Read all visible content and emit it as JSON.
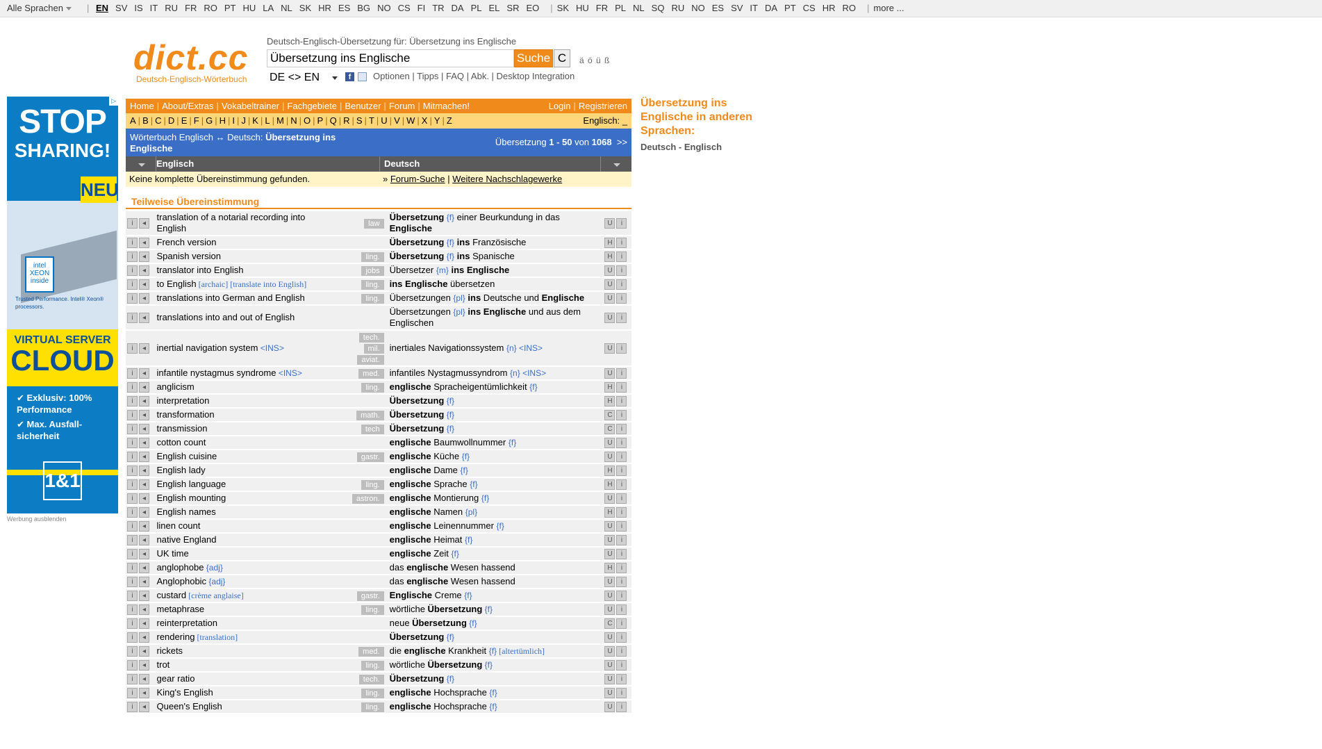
{
  "langbar": {
    "all_languages": "Alle Sprachen",
    "group1": [
      "EN",
      "SV",
      "IS",
      "IT",
      "RU",
      "FR",
      "RO",
      "PT",
      "HU",
      "LA",
      "NL",
      "SK",
      "HR",
      "ES",
      "BG",
      "NO",
      "CS",
      "FI",
      "TR",
      "DA",
      "PL",
      "EL",
      "SR",
      "EO"
    ],
    "group2": [
      "SK",
      "HU",
      "FR",
      "PL",
      "NL",
      "SQ",
      "RU",
      "NO",
      "ES",
      "SV",
      "IT",
      "DA",
      "PT",
      "CS",
      "HR",
      "RO"
    ],
    "more": "more ..."
  },
  "header": {
    "logo": "dict.cc",
    "logo_subtitle": "Deutsch-Englisch-Wörterbuch",
    "search_heading": "Deutsch-Englisch-Übersetzung für: Übersetzung ins Englische",
    "search_value": "Übersetzung ins Englische",
    "search_button": "Suche",
    "clear_button": "C",
    "special_chars": "ä ö ü ß",
    "lang_select": "DE <> EN",
    "util_links": "Optionen | Tipps | FAQ | Abk. | Desktop Integration"
  },
  "nav": {
    "items": [
      "Home",
      "About/Extras",
      "Vokabeltrainer",
      "Fachgebiete",
      "Benutzer",
      "Forum",
      "Mitmachen!"
    ],
    "login": "Login",
    "register": "Registrieren"
  },
  "alphabet": {
    "letters": [
      "A",
      "B",
      "C",
      "D",
      "E",
      "F",
      "G",
      "H",
      "I",
      "J",
      "K",
      "L",
      "M",
      "N",
      "O",
      "P",
      "Q",
      "R",
      "S",
      "T",
      "U",
      "V",
      "W",
      "X",
      "Y",
      "Z"
    ],
    "right": "Englisch: _"
  },
  "wbhead": {
    "left_prefix": "Wörterbuch Englisch ↔ Deutsch: ",
    "left_bold": "Übersetzung ins Englische",
    "right_prefix": "Übersetzung ",
    "range": "1 - 50",
    "of_word": " von ",
    "total": "1068",
    "next": ">>"
  },
  "columns": {
    "english": "Englisch",
    "deutsch": "Deutsch"
  },
  "nomatch": {
    "text": "Keine komplette Übereinstimmung gefunden.",
    "prefix": "» ",
    "forum": "Forum-Suche",
    "sep": " | ",
    "more": "Weitere Nachschlagewerke"
  },
  "partial_heading": "Teilweise Übereinstimmung",
  "results": [
    {
      "en": "translation of a notarial recording into English",
      "tags": [
        "law"
      ],
      "de": [
        [
          "b",
          "Übersetzung"
        ],
        [
          "g",
          " {f}"
        ],
        [
          "n",
          " einer Beurkundung in das "
        ],
        [
          "b",
          "Englische"
        ]
      ],
      "v": "U"
    },
    {
      "en": "French version",
      "tags": [],
      "de": [
        [
          "b",
          "Übersetzung"
        ],
        [
          "g",
          " {f}"
        ],
        [
          "n",
          " "
        ],
        [
          "b",
          "ins"
        ],
        [
          "n",
          " Französische"
        ]
      ],
      "v": "H"
    },
    {
      "en": "Spanish version",
      "tags": [
        "ling."
      ],
      "de": [
        [
          "b",
          "Übersetzung"
        ],
        [
          "g",
          " {f}"
        ],
        [
          "n",
          " "
        ],
        [
          "b",
          "ins"
        ],
        [
          "n",
          " Spanische"
        ]
      ],
      "v": "H"
    },
    {
      "en": "translator into English",
      "tags": [
        "jobs"
      ],
      "de": [
        [
          "n",
          "Übersetzer "
        ],
        [
          "g",
          "{m}"
        ],
        [
          "n",
          " "
        ],
        [
          "b",
          "ins Englische"
        ]
      ],
      "v": "U"
    },
    {
      "en": "to English",
      "en_note": " [archaic] [translate into English]",
      "tags": [
        "ling."
      ],
      "de": [
        [
          "b",
          "ins Englische"
        ],
        [
          "n",
          " übersetzen"
        ]
      ],
      "v": "U"
    },
    {
      "en": "translations into German and English",
      "tags": [
        "ling."
      ],
      "de": [
        [
          "n",
          "Übersetzungen "
        ],
        [
          "g",
          "{pl}"
        ],
        [
          "n",
          " "
        ],
        [
          "b",
          "ins"
        ],
        [
          "n",
          " Deutsche und "
        ],
        [
          "b",
          "Englische"
        ]
      ],
      "v": "U"
    },
    {
      "en": "translations into and out of English",
      "tags": [],
      "de": [
        [
          "n",
          "Übersetzungen "
        ],
        [
          "g",
          "{pl}"
        ],
        [
          "n",
          " "
        ],
        [
          "b",
          "ins Englische"
        ],
        [
          "n",
          " und aus dem Englischen"
        ]
      ],
      "v": "U"
    },
    {
      "en": "inertial navigation system",
      "en_ins": " <INS>",
      "tags": [
        "tech.",
        "mil.",
        "aviat."
      ],
      "de": [
        [
          "n",
          "inertiales Navigationssystem "
        ],
        [
          "g",
          "{n}"
        ],
        [
          "g",
          " <INS>"
        ]
      ],
      "v": "U"
    },
    {
      "en": "infantile nystagmus syndrome",
      "en_ins": " <INS>",
      "tags": [
        "med."
      ],
      "de": [
        [
          "n",
          "infantiles Nystagmussyndrom "
        ],
        [
          "g",
          "{n}"
        ],
        [
          "g",
          " <INS>"
        ]
      ],
      "v": "U"
    },
    {
      "en": "anglicism",
      "tags": [
        "ling."
      ],
      "de": [
        [
          "b",
          "englische"
        ],
        [
          "n",
          " Spracheigentümlichkeit "
        ],
        [
          "g",
          "{f}"
        ]
      ],
      "v": "H"
    },
    {
      "en": "interpretation",
      "tags": [],
      "de": [
        [
          "b",
          "Übersetzung"
        ],
        [
          "g",
          " {f}"
        ]
      ],
      "v": "H"
    },
    {
      "en": "transformation",
      "tags": [
        "math."
      ],
      "de": [
        [
          "b",
          "Übersetzung"
        ],
        [
          "g",
          " {f}"
        ]
      ],
      "v": "C"
    },
    {
      "en": "transmission",
      "tags": [
        "tech"
      ],
      "de": [
        [
          "b",
          "Übersetzung"
        ],
        [
          "g",
          " {f}"
        ]
      ],
      "v": "C"
    },
    {
      "en": "cotton count",
      "tags": [],
      "de": [
        [
          "b",
          "englische"
        ],
        [
          "n",
          " Baumwollnummer "
        ],
        [
          "g",
          "{f}"
        ]
      ],
      "v": "U"
    },
    {
      "en": "English cuisine",
      "tags": [
        "gastr."
      ],
      "de": [
        [
          "b",
          "englische"
        ],
        [
          "n",
          " Küche "
        ],
        [
          "g",
          "{f}"
        ]
      ],
      "v": "U"
    },
    {
      "en": "English lady",
      "tags": [],
      "de": [
        [
          "b",
          "englische"
        ],
        [
          "n",
          " Dame "
        ],
        [
          "g",
          "{f}"
        ]
      ],
      "v": "H"
    },
    {
      "en": "English language",
      "tags": [
        "ling."
      ],
      "de": [
        [
          "b",
          "englische"
        ],
        [
          "n",
          " Sprache "
        ],
        [
          "g",
          "{f}"
        ]
      ],
      "v": "H"
    },
    {
      "en": "English mounting",
      "tags": [
        "astron."
      ],
      "de": [
        [
          "b",
          "englische"
        ],
        [
          "n",
          " Montierung "
        ],
        [
          "g",
          "{f}"
        ]
      ],
      "v": "U"
    },
    {
      "en": "English names",
      "tags": [],
      "de": [
        [
          "b",
          "englische"
        ],
        [
          "n",
          " Namen "
        ],
        [
          "g",
          "{pl}"
        ]
      ],
      "v": "H"
    },
    {
      "en": "linen count",
      "tags": [],
      "de": [
        [
          "b",
          "englische"
        ],
        [
          "n",
          " Leinennummer "
        ],
        [
          "g",
          "{f}"
        ]
      ],
      "v": "U"
    },
    {
      "en": "native England",
      "tags": [],
      "de": [
        [
          "b",
          "englische"
        ],
        [
          "n",
          " Heimat "
        ],
        [
          "g",
          "{f}"
        ]
      ],
      "v": "U"
    },
    {
      "en": "UK time",
      "tags": [],
      "de": [
        [
          "b",
          "englische"
        ],
        [
          "n",
          " Zeit "
        ],
        [
          "g",
          "{f}"
        ]
      ],
      "v": "U"
    },
    {
      "en": "anglophobe",
      "en_gram": " {adj}",
      "tags": [],
      "de": [
        [
          "n",
          "das "
        ],
        [
          "b",
          "englische"
        ],
        [
          "n",
          " Wesen hassend"
        ]
      ],
      "v": "H"
    },
    {
      "en": "Anglophobic",
      "en_gram": " {adj}",
      "tags": [],
      "de": [
        [
          "n",
          "das "
        ],
        [
          "b",
          "englische"
        ],
        [
          "n",
          " Wesen hassend"
        ]
      ],
      "v": "U"
    },
    {
      "en": "custard",
      "en_note": " [crème anglaise]",
      "tags": [
        "gastr."
      ],
      "de": [
        [
          "b",
          "Englische"
        ],
        [
          "n",
          " Creme "
        ],
        [
          "g",
          "{f}"
        ]
      ],
      "v": "U"
    },
    {
      "en": "metaphrase",
      "tags": [
        "ling."
      ],
      "de": [
        [
          "n",
          "wörtliche "
        ],
        [
          "b",
          "Übersetzung"
        ],
        [
          "g",
          " {f}"
        ]
      ],
      "v": "U"
    },
    {
      "en": "reinterpretation",
      "tags": [],
      "de": [
        [
          "n",
          "neue "
        ],
        [
          "b",
          "Übersetzung"
        ],
        [
          "g",
          " {f}"
        ]
      ],
      "v": "C"
    },
    {
      "en": "rendering",
      "en_note": " [translation]",
      "tags": [],
      "de": [
        [
          "b",
          "Übersetzung"
        ],
        [
          "g",
          " {f}"
        ]
      ],
      "v": "U"
    },
    {
      "en": "rickets",
      "tags": [
        "med."
      ],
      "de": [
        [
          "n",
          "die "
        ],
        [
          "b",
          "englische"
        ],
        [
          "n",
          " Krankheit "
        ],
        [
          "g",
          "{f}"
        ],
        [
          "x",
          " [altertümlich]"
        ]
      ],
      "v": "U"
    },
    {
      "en": "trot",
      "tags": [
        "ling."
      ],
      "de": [
        [
          "n",
          "wörtliche "
        ],
        [
          "b",
          "Übersetzung"
        ],
        [
          "g",
          " {f}"
        ]
      ],
      "v": "U"
    },
    {
      "en": "gear ratio",
      "tags": [
        "tech."
      ],
      "de": [
        [
          "b",
          "Übersetzung"
        ],
        [
          "g",
          " {f}"
        ]
      ],
      "v": "U"
    },
    {
      "en": "King's English",
      "tags": [
        "ling."
      ],
      "de": [
        [
          "b",
          "englische"
        ],
        [
          "n",
          " Hochsprache "
        ],
        [
          "g",
          "{f}"
        ]
      ],
      "v": "U"
    },
    {
      "en": "Queen's English",
      "tags": [
        "ling."
      ],
      "de": [
        [
          "b",
          "englische"
        ],
        [
          "n",
          " Hochsprache "
        ],
        [
          "g",
          "{f}"
        ]
      ],
      "v": "U"
    }
  ],
  "ad": {
    "stop": "STOP",
    "sharing": "SHARING!",
    "neu": "NEU",
    "intel": "intel XEON inside",
    "perf": "Trusted Performance. Intel® Xeon® processors.",
    "virtual": "VIRTUAL SERVER",
    "cloud": "CLOUD",
    "bullet1": "Exklusiv: 100% Performance",
    "bullet2": "Max. Ausfall-sicherheit",
    "brand": "1&1",
    "hide": "Werbung ausblenden"
  },
  "sidebar": {
    "heading": "Übersetzung ins Englische in anderen Sprachen:",
    "link": "Deutsch - Englisch"
  },
  "colors": {
    "accent": "#f08a1a",
    "blue": "#3b6fc7",
    "row": "#f0f0f0"
  }
}
